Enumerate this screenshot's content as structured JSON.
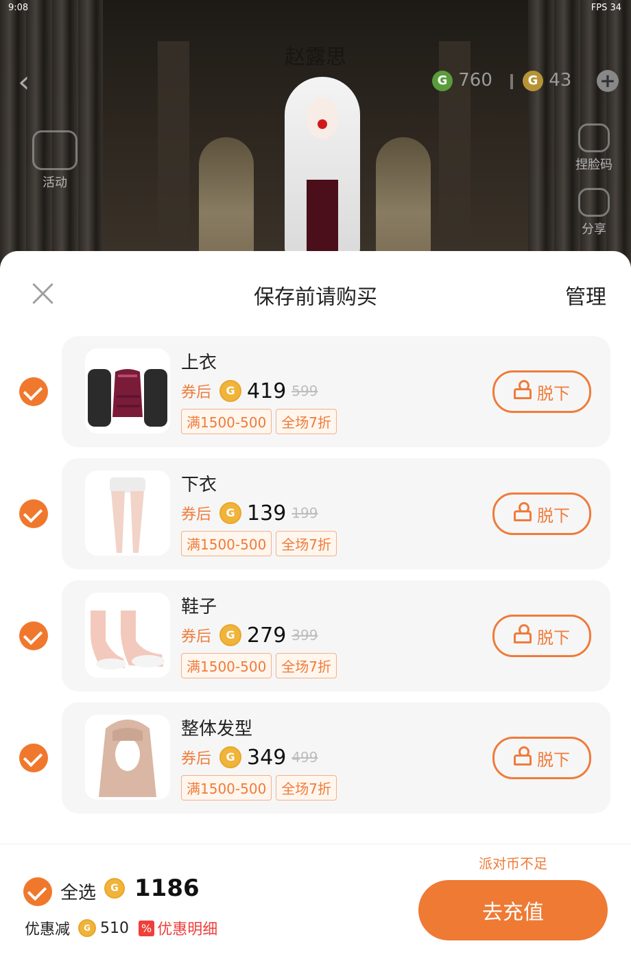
{
  "status_bar": {
    "time": "9:08",
    "right": "FPS  34"
  },
  "scene": {
    "player_name": "赵露思",
    "green_currency": "760",
    "gold_currency": "43",
    "side_items": {
      "activity": "活动",
      "face_code": "捏脸码",
      "share": "分享"
    }
  },
  "sheet": {
    "title": "保存前请购买",
    "manage_label": "管理"
  },
  "items": [
    {
      "name": "上衣",
      "price_prefix": "券后",
      "price": "419",
      "original_price": "599",
      "tags": [
        "满1500-500",
        "全场7折"
      ],
      "remove_label": "脱下"
    },
    {
      "name": "下衣",
      "price_prefix": "券后",
      "price": "139",
      "original_price": "199",
      "tags": [
        "满1500-500",
        "全场7折"
      ],
      "remove_label": "脱下"
    },
    {
      "name": "鞋子",
      "price_prefix": "券后",
      "price": "279",
      "original_price": "399",
      "tags": [
        "满1500-500",
        "全场7折"
      ],
      "remove_label": "脱下"
    },
    {
      "name": "整体发型",
      "price_prefix": "券后",
      "price": "349",
      "original_price": "499",
      "tags": [
        "满1500-500",
        "全场7折"
      ],
      "remove_label": "脱下"
    }
  ],
  "footer": {
    "select_all_label": "全选",
    "total": "1186",
    "discount_label": "优惠减",
    "discount_value": "510",
    "discount_badge": "%",
    "discount_detail_label": "优惠明细",
    "insufficient_label": "派对币不足",
    "recharge_label": "去充值"
  },
  "colors": {
    "accent": "#ee7a34",
    "tag_text": "#ef7b3a",
    "discount_red": "#ef3f3a"
  }
}
